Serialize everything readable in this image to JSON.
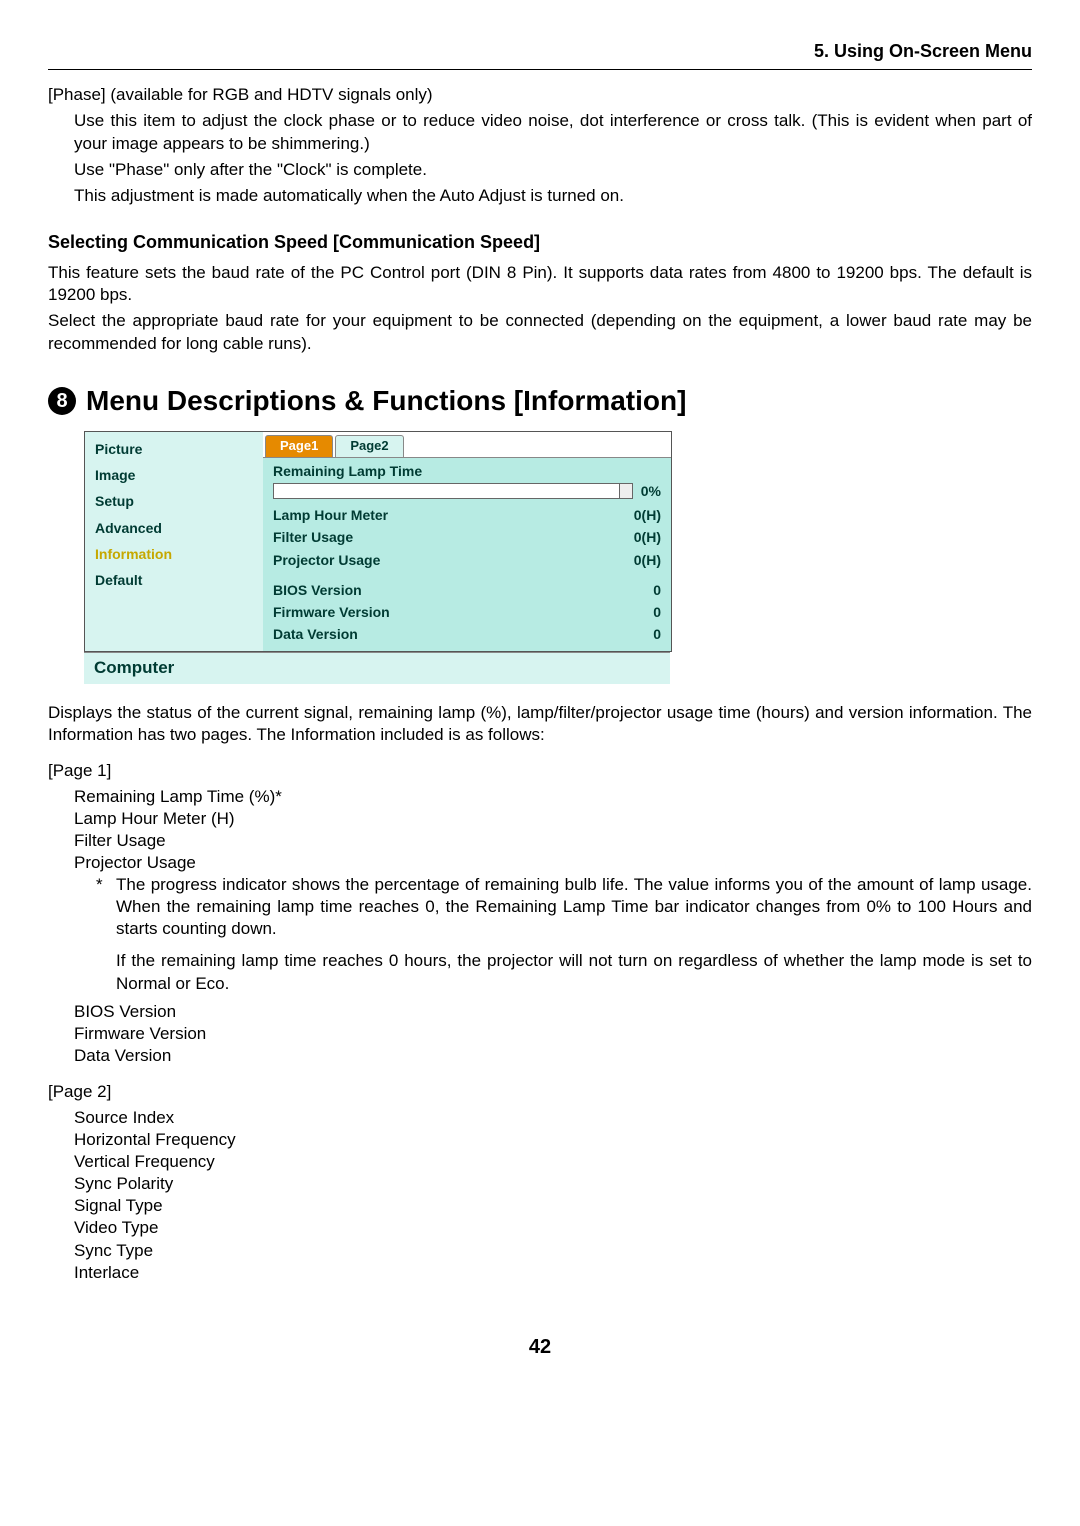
{
  "chapter_header": "5. Using On-Screen Menu",
  "phase": {
    "title": "[Phase] (available for RGB and HDTV signals only)",
    "line1": "Use this item to adjust the clock phase or to reduce video noise, dot interference or cross talk. (This is evident when part of your image appears to be shimmering.)",
    "line2": "Use \"Phase\" only after the \"Clock\" is complete.",
    "line3": "This adjustment is made automatically when the Auto Adjust is turned on."
  },
  "comm_speed": {
    "heading": "Selecting Communication Speed [Communication Speed]",
    "p1": "This feature sets the baud rate of the PC Control port (DIN 8 Pin). It supports data rates from 4800 to 19200 bps. The default is 19200 bps.",
    "p2": "Select the appropriate baud rate for your equipment to be connected (depending on the equipment, a lower baud rate may be recommended for long cable runs)."
  },
  "section": {
    "number": "8",
    "title": "Menu Descriptions & Functions [Information]"
  },
  "osd": {
    "menu_items": [
      "Picture",
      "Image",
      "Setup",
      "Advanced",
      "Information",
      "Default"
    ],
    "selected_index": 4,
    "tabs": [
      "Page1",
      "Page2"
    ],
    "active_tab": 0,
    "remaining_lamp_label": "Remaining Lamp Time",
    "remaining_lamp_value": "0%",
    "rows": [
      {
        "label": "Lamp Hour Meter",
        "value": "0(H)"
      },
      {
        "label": "Filter Usage",
        "value": "0(H)"
      },
      {
        "label": "Projector Usage",
        "value": "0(H)"
      }
    ],
    "rows2": [
      {
        "label": "BIOS Version",
        "value": "0"
      },
      {
        "label": "Firmware Version",
        "value": "0"
      },
      {
        "label": "Data Version",
        "value": "0"
      }
    ],
    "footer": "Computer"
  },
  "info_intro": "Displays the status of the current signal, remaining lamp (%), lamp/filter/projector usage time (hours) and version information. The Information has two pages. The Information included is as follows:",
  "page1": {
    "label": "[Page 1]",
    "items": [
      "Remaining Lamp Time (%)*",
      "Lamp Hour Meter (H)",
      "Filter Usage",
      "Projector Usage"
    ],
    "note_star": "*",
    "note1": "The progress indicator shows the percentage of remaining bulb life. The value informs you of the amount of lamp usage. When the remaining lamp time reaches 0, the Remaining Lamp Time bar indicator changes from 0% to 100 Hours and starts counting down.",
    "note2": "If the remaining lamp time reaches 0 hours, the projector will not turn on regardless of whether the lamp mode is set to Normal or Eco.",
    "items2": [
      "BIOS Version",
      "Firmware Version",
      "Data Version"
    ]
  },
  "page2": {
    "label": "[Page 2]",
    "items": [
      "Source Index",
      "Horizontal Frequency",
      "Vertical Frequency",
      "Sync Polarity",
      "Signal Type",
      "Video Type",
      "Sync Type",
      "Interlace"
    ]
  },
  "page_number": "42"
}
